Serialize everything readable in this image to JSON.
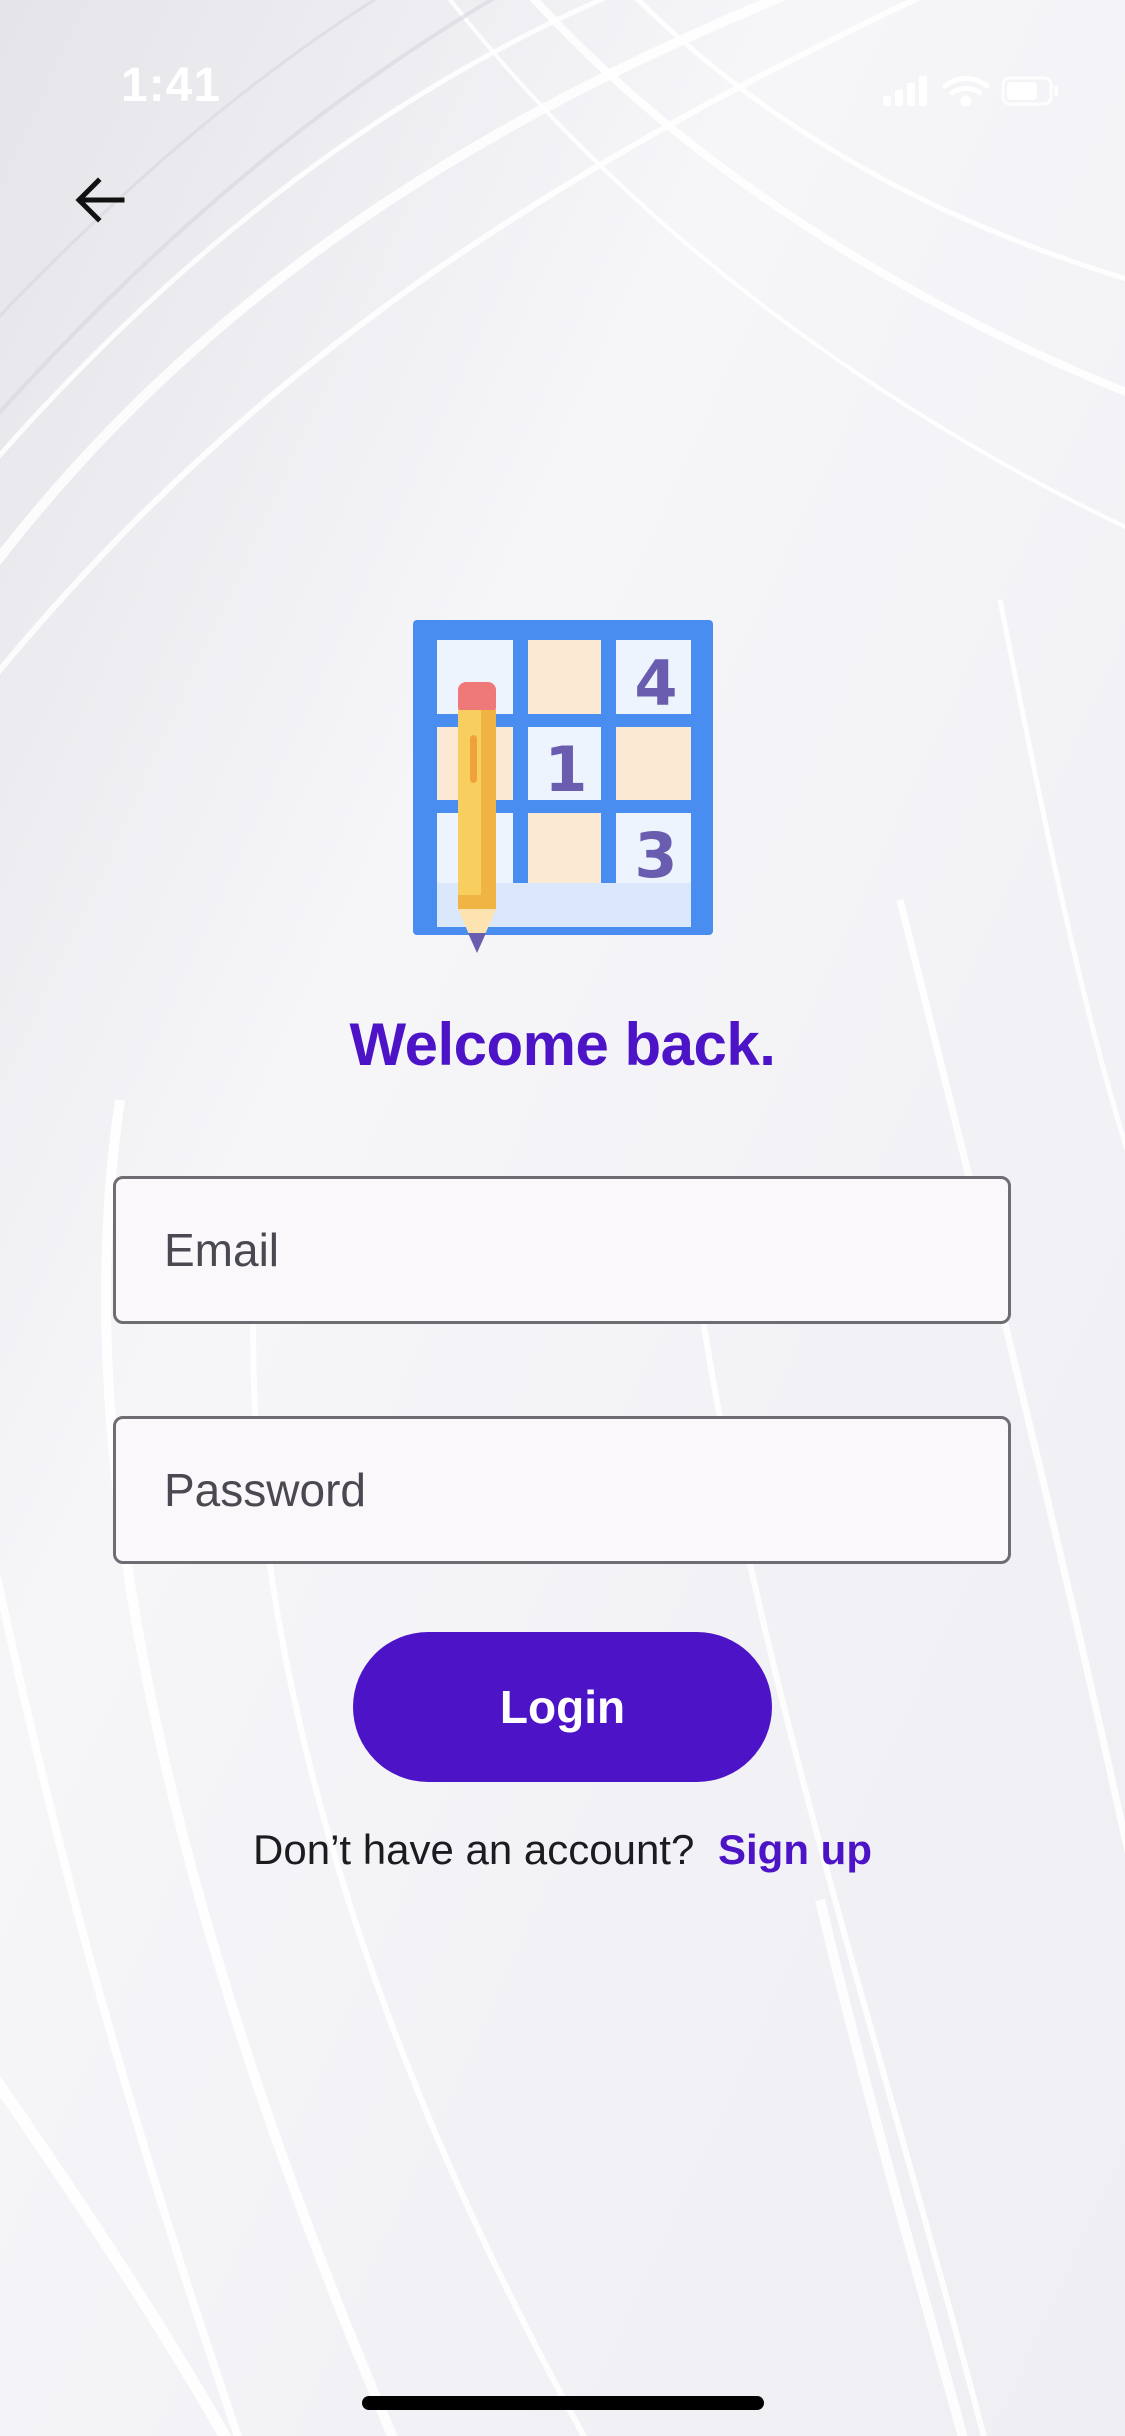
{
  "status_bar": {
    "time": "1:41"
  },
  "nav": {
    "back_icon": "arrow-left-icon"
  },
  "logo": {
    "icon": "sudoku-grid-pencil-icon",
    "digits": [
      "4",
      "1",
      "3"
    ]
  },
  "welcome_title": "Welcome back.",
  "form": {
    "email_placeholder": "Email",
    "password_placeholder": "Password",
    "login_label": "Login"
  },
  "signup": {
    "prompt": "Don’t have an account?",
    "link_label": "Sign up"
  },
  "colors": {
    "accent": "#4c14c6",
    "field_border": "#6f6c74",
    "field_background": "#fbf8fb",
    "grid_blue": "#4a8df0",
    "digit_purple": "#6a5cae"
  }
}
